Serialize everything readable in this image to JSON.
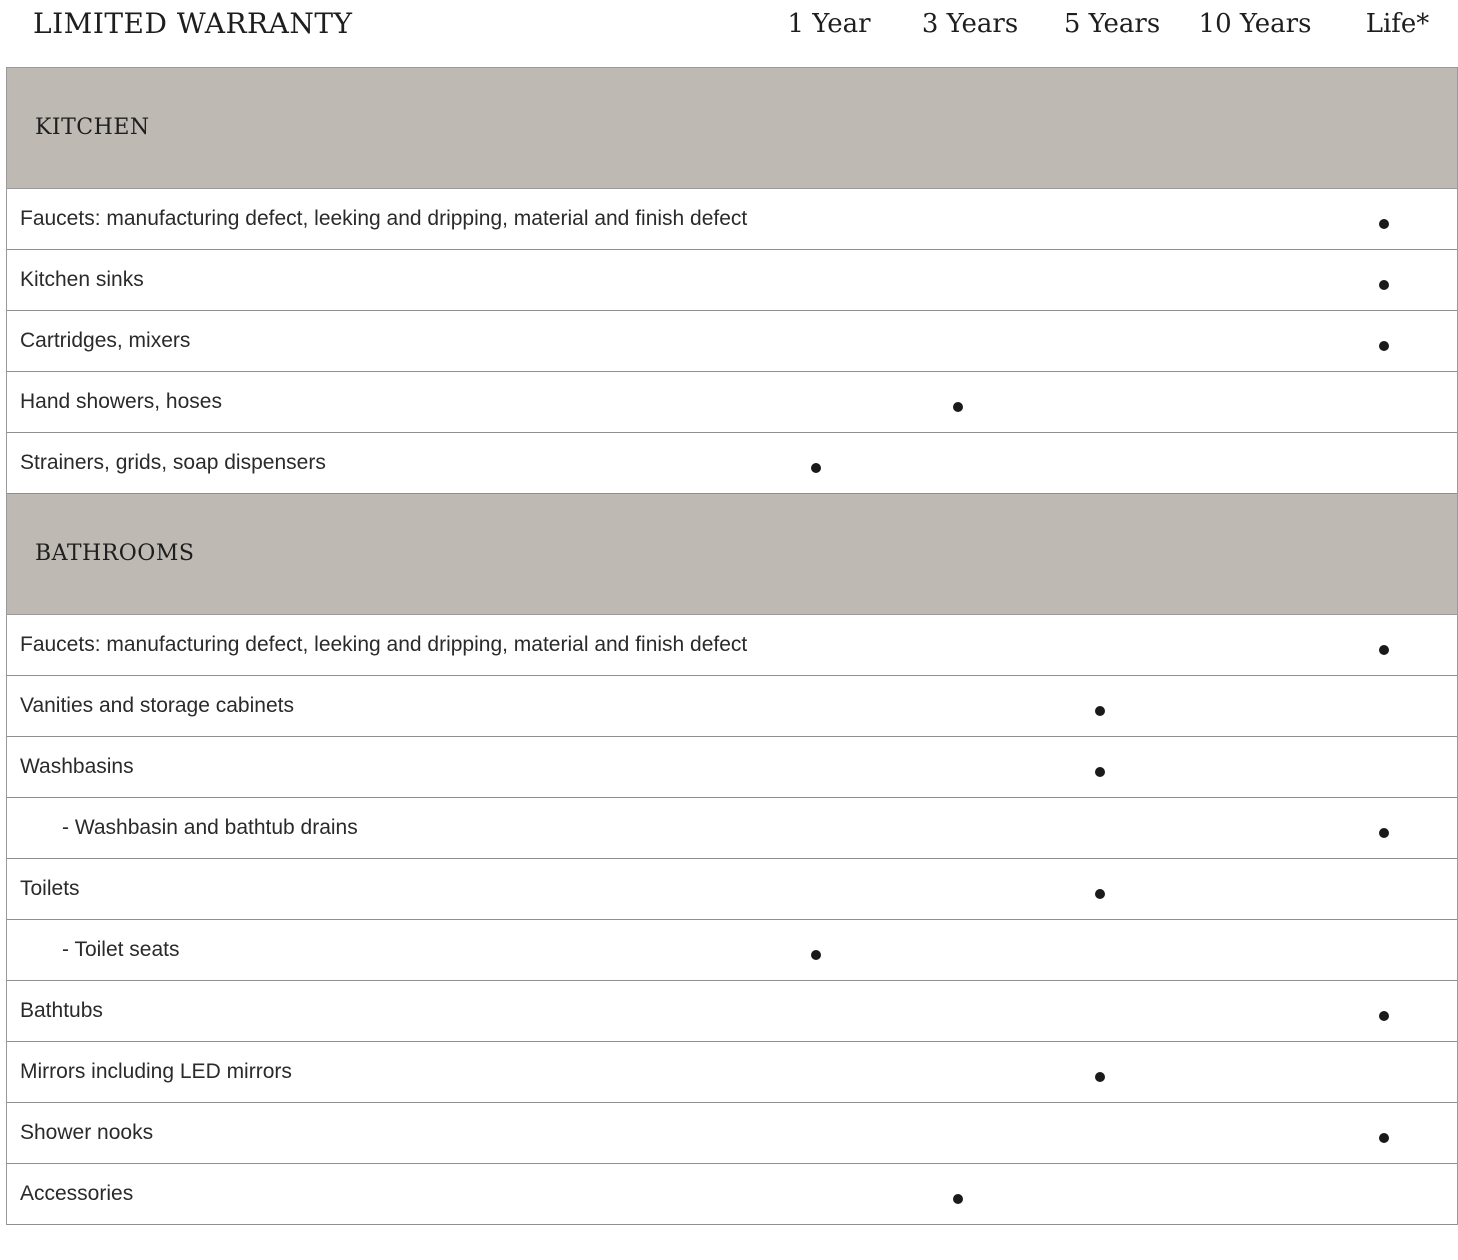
{
  "title": "LIMITED WARRANTY",
  "columns": [
    "1 Year",
    "3 Years",
    "5 Years",
    "10 Years",
    "Life*"
  ],
  "sections": [
    {
      "name": "KITCHEN",
      "rows": [
        {
          "label": "Faucets: manufacturing defect, leeking and dripping, material and finish defect",
          "warranty": "Life*"
        },
        {
          "label": "Kitchen sinks",
          "warranty": "Life*"
        },
        {
          "label": "Cartridges, mixers",
          "warranty": "Life*"
        },
        {
          "label": "Hand showers, hoses",
          "warranty": "3 Years"
        },
        {
          "label": "Strainers, grids, soap dispensers",
          "warranty": "1 Year"
        }
      ]
    },
    {
      "name": "BATHROOMS",
      "rows": [
        {
          "label": "Faucets: manufacturing defect, leeking and dripping, material and finish defect",
          "warranty": "Life*"
        },
        {
          "label": "Vanities and storage cabinets",
          "warranty": "5 Years"
        },
        {
          "label": "Washbasins",
          "warranty": "5 Years"
        },
        {
          "label": "- Washbasin and bathtub drains",
          "warranty": "Life*",
          "indent": true
        },
        {
          "label": "Toilets",
          "warranty": "5 Years"
        },
        {
          "label": "- Toilet seats",
          "warranty": "1 Year",
          "indent": true
        },
        {
          "label": "Bathtubs",
          "warranty": "Life*"
        },
        {
          "label": "Mirrors including LED mirrors",
          "warranty": "5 Years"
        },
        {
          "label": "Shower nooks",
          "warranty": "Life*"
        },
        {
          "label": "Accessories",
          "warranty": "3 Years"
        }
      ]
    }
  ]
}
